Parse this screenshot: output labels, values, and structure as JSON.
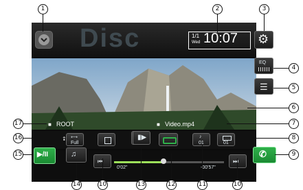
{
  "callouts": [
    "1",
    "2",
    "3",
    "4",
    "5",
    "6",
    "7",
    "8",
    "9",
    "10",
    "11",
    "12",
    "13",
    "14",
    "15",
    "16",
    "17"
  ],
  "callout_labels": {
    "c10a": "10",
    "c10b": "10"
  },
  "header": {
    "date_top": "1/1",
    "date_day": "Wed",
    "time": "10:07",
    "bg_word": "Disc"
  },
  "video": {
    "folder_text": "ROOT",
    "file_text": "Video.mp4"
  },
  "side": {
    "eq_label": "EQ"
  },
  "row1": {
    "full_label": "Full",
    "audio_number": "01",
    "subtitle_number": "01"
  },
  "progress": {
    "elapsed": "0'02\"",
    "remaining": "-00'57\"",
    "fraction": 0.45
  },
  "colors": {
    "accent_green": "#22a03f",
    "screen_bg": "#0b0b0b"
  }
}
